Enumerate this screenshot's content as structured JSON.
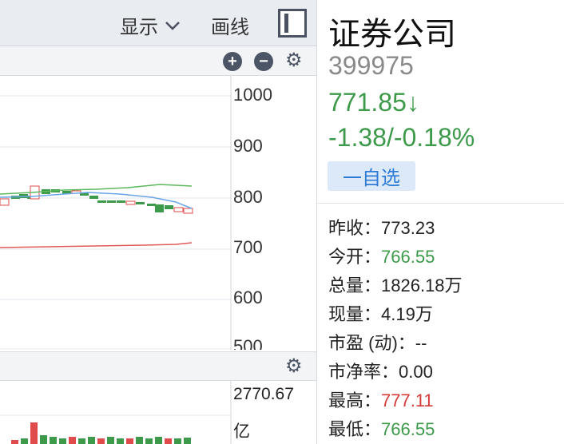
{
  "toolbar": {
    "display_label": "显示",
    "draw_label": "画线"
  },
  "chart": {
    "ticks": [
      "1000",
      "900",
      "800",
      "700",
      "600",
      "500"
    ],
    "colors": {
      "up": "#e04a4a",
      "down": "#3c9a4a",
      "ma_green": "#5cb85c",
      "ma_blue": "#6aa5e8",
      "ma_red": "#e05a5a"
    }
  },
  "volume": {
    "value": "2770.67",
    "unit": "亿"
  },
  "stock": {
    "name": "证券公司",
    "code": "399975",
    "price": "771.85↓",
    "change": "-1.38/-0.18%",
    "watch_label": "一自选"
  },
  "stats": [
    {
      "label": "昨收：",
      "value": "773.23",
      "tone": ""
    },
    {
      "label": "今开：",
      "value": "766.55",
      "tone": "green"
    },
    {
      "label": "总量：",
      "value": "1826.18万",
      "tone": ""
    },
    {
      "label": "现量：",
      "value": "4.19万",
      "tone": ""
    },
    {
      "label": "市盈 (动)：",
      "value": "--",
      "tone": ""
    },
    {
      "label": "市净率：",
      "value": "0.00",
      "tone": ""
    },
    {
      "label": "最高：",
      "value": "777.11",
      "tone": "red"
    },
    {
      "label": "最低：",
      "value": "766.55",
      "tone": "green"
    }
  ]
}
